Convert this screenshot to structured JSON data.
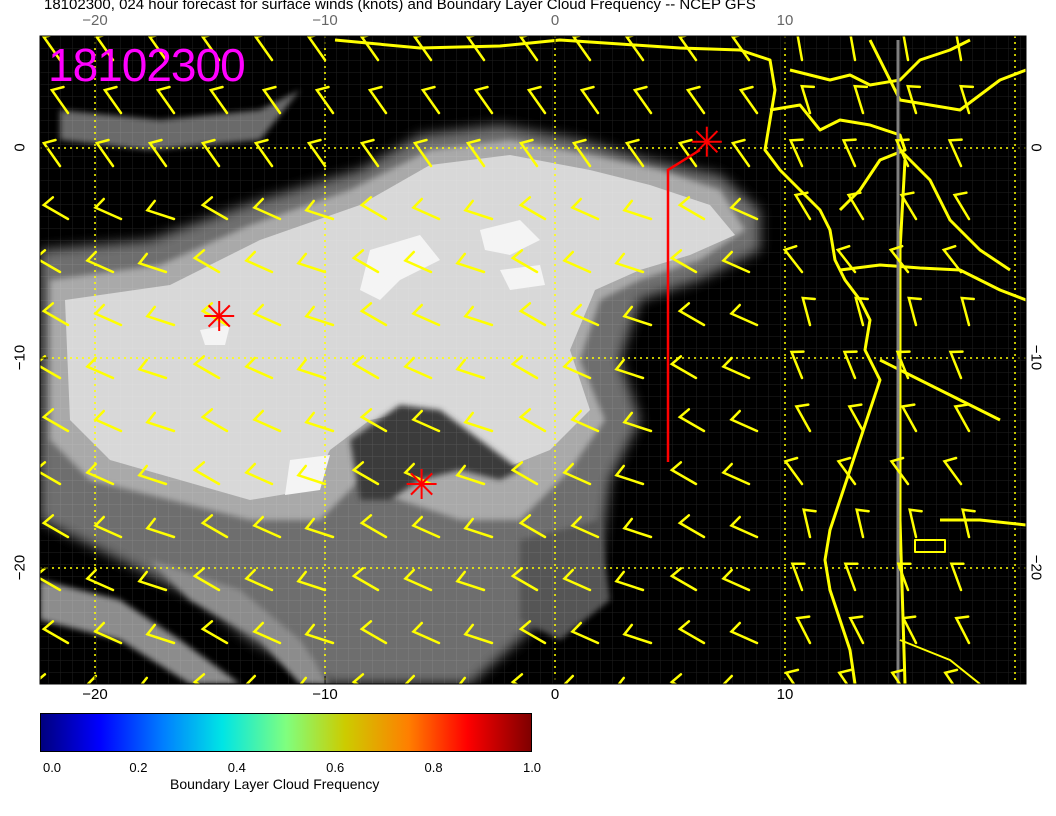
{
  "title": "18102300, 024 hour forecast for surface winds (knots) and Boundary Layer Cloud Frequency -- NCEP GFS",
  "stamp": "18102300",
  "colors": {
    "coast": "#ffff00",
    "barb": "#ffff00",
    "track": "#ff0000",
    "stamp": "#ff00ff",
    "grid": "#ffff00"
  },
  "axes": {
    "lon_ticks": [
      "−20",
      "−10",
      "0",
      "10"
    ],
    "lat_ticks": [
      "0",
      "−10",
      "−20"
    ]
  },
  "markers": [
    {
      "label": "red-star",
      "lon": -14.6,
      "lat": -8.0
    },
    {
      "label": "red-star",
      "lon": -5.8,
      "lat": -16.0
    },
    {
      "label": "red-star",
      "lon": 6.6,
      "lat": 0.3
    }
  ],
  "colorbar": {
    "label": "Boundary Layer Cloud Frequency",
    "ticks": [
      "0.0",
      "0.2",
      "0.4",
      "0.6",
      "0.8",
      "1.0"
    ]
  }
}
